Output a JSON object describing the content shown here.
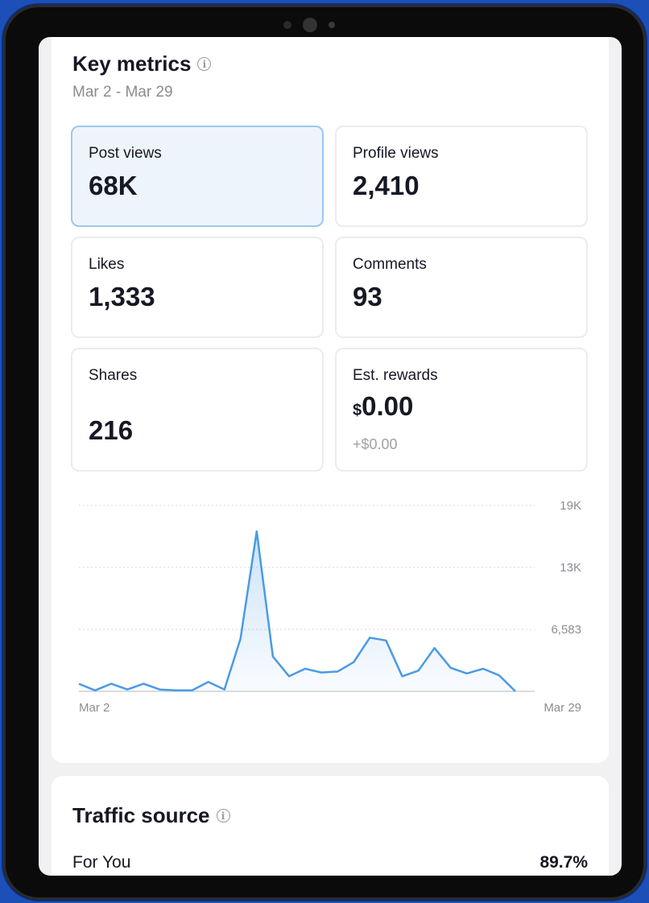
{
  "key_metrics": {
    "title": "Key metrics",
    "date_range": "Mar 2 - Mar 29",
    "tiles": [
      {
        "label": "Post views",
        "value": "68K"
      },
      {
        "label": "Profile views",
        "value": "2,410"
      },
      {
        "label": "Likes",
        "value": "1,333"
      },
      {
        "label": "Comments",
        "value": "93"
      },
      {
        "label": "Shares",
        "value": "216"
      },
      {
        "label": "Est. rewards",
        "currency": "$",
        "value": "0.00",
        "sub": "+$0.00"
      }
    ]
  },
  "chart_data": {
    "type": "area",
    "title": "",
    "xlabel": "",
    "ylabel": "",
    "x_tick_labels": [
      "Mar 2",
      "Mar 29"
    ],
    "y_tick_labels": [
      "19K",
      "13K",
      "6,583"
    ],
    "y_ticks": [
      19749,
      13166,
      6583
    ],
    "ylim": [
      0,
      19749
    ],
    "grid": true,
    "color": "#4a9ae6",
    "x": [
      "Mar 2",
      "Mar 3",
      "Mar 4",
      "Mar 5",
      "Mar 6",
      "Mar 7",
      "Mar 8",
      "Mar 9",
      "Mar 10",
      "Mar 11",
      "Mar 12",
      "Mar 13",
      "Mar 14",
      "Mar 15",
      "Mar 16",
      "Mar 17",
      "Mar 18",
      "Mar 19",
      "Mar 20",
      "Mar 21",
      "Mar 22",
      "Mar 23",
      "Mar 24",
      "Mar 25",
      "Mar 26",
      "Mar 27",
      "Mar 28",
      "Mar 29"
    ],
    "values": [
      800,
      100,
      800,
      200,
      800,
      200,
      100,
      100,
      1000,
      200,
      5600,
      17000,
      3700,
      1600,
      2400,
      2000,
      2100,
      3100,
      5700,
      5400,
      1600,
      2200,
      4600,
      2500,
      1900,
      2400,
      1700,
      0
    ]
  },
  "traffic_source": {
    "title": "Traffic source",
    "rows": [
      {
        "label": "For You",
        "value": "89.7%"
      }
    ]
  }
}
